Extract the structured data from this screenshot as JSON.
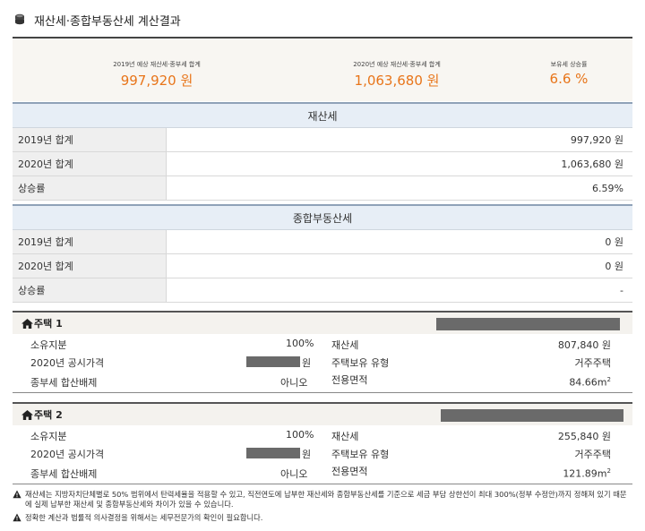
{
  "header": {
    "title": "재산세·종합부동산세 계산결과",
    "icon": "coins-icon"
  },
  "summary": [
    {
      "label": "2019년 예상 재산세·종부세 합계",
      "value": "997,920 원"
    },
    {
      "label": "2020년 예상 재산세·종부세 합계",
      "value": "1,063,680 원"
    },
    {
      "label": "보유세 상승률",
      "value": "6.6 %"
    }
  ],
  "property_tax": {
    "title": "재산세",
    "rows": [
      {
        "label": "2019년 합계",
        "value": "997,920 원"
      },
      {
        "label": "2020년 합계",
        "value": "1,063,680 원"
      },
      {
        "label": "상승률",
        "value": "6.59%"
      }
    ]
  },
  "comprehensive_tax": {
    "title": "종합부동산세",
    "rows": [
      {
        "label": "2019년 합계",
        "value": "0 원"
      },
      {
        "label": "2020년 합계",
        "value": "0 원"
      },
      {
        "label": "상승률",
        "value": "-"
      }
    ]
  },
  "houses": [
    {
      "name": "주택 1",
      "share_label": "소유지분",
      "share_value": "100%",
      "price_label": "2020년 공시가격",
      "price_unit": "원",
      "exclusion_label": "종부세 합산배제",
      "exclusion_value": "아니오",
      "tax_label": "재산세",
      "tax_value": "807,840 원",
      "type_label": "주택보유 유형",
      "type_value": "거주주택",
      "area_label": "전용면적",
      "area_value": "84.66m",
      "area_sup": "2"
    },
    {
      "name": "주택 2",
      "share_label": "소유지분",
      "share_value": "100%",
      "price_label": "2020년 공시가격",
      "price_unit": "원",
      "exclusion_label": "종부세 합산배제",
      "exclusion_value": "아니오",
      "tax_label": "재산세",
      "tax_value": "255,840 원",
      "type_label": "주택보유 유형",
      "type_value": "거주주택",
      "area_label": "전용면적",
      "area_value": "121.89m",
      "area_sup": "2"
    }
  ],
  "notes": [
    "재산세는 지방자치단체별로 50% 범위에서 탄력세율을 적용할 수 있고, 직전연도에 납부한 재산세와 종합부동산세를 기준으로 세금 부담 상한선이 최대 300%(정부 수정안)까지 정해져 있기 때문에 실제 납부한 재산세 및 종합부동산세와 차이가 있을 수 있습니다.",
    "정확한 계산과 법률적 의사결정을 위해서는 세무전문가의 확인이 필요합니다."
  ],
  "colors": {
    "accent": "#e8751a",
    "section_head": "#e7eef6",
    "redaction": "#6a6a6a"
  }
}
